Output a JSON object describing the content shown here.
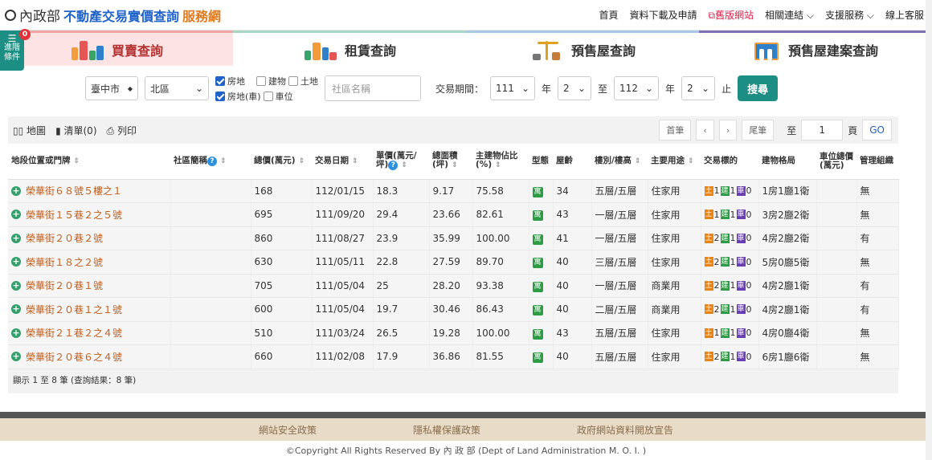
{
  "brand": {
    "ministry": "內政部",
    "title_blue": "不動產交易實價查詢",
    "title_orange": "服務網"
  },
  "topnav": [
    "首頁",
    "資料下載及申請",
    "舊版網站",
    "相關連結 ⌵",
    "支援服務 ⌵",
    "線上客服"
  ],
  "adv": {
    "label": "進階條件",
    "badge": "0"
  },
  "tabs": [
    "買賣查詢",
    "租賃查詢",
    "預售屋查詢",
    "預售屋建案查詢"
  ],
  "filters": {
    "city": "臺中市",
    "district": "北區",
    "chk1": "房地",
    "chk2": "建物",
    "chk3": "土地",
    "chk4": "房地(車)",
    "chk5": "車位",
    "community_placeholder": "社區名稱",
    "period_label": "交易期間：",
    "y1": "111",
    "m1": "2",
    "to": "至",
    "y2": "112",
    "m2": "2",
    "year": "年",
    "stop": "止",
    "search": "搜尋"
  },
  "tools": {
    "map": "地圖",
    "list": "清單(0)",
    "print": "列印"
  },
  "pager": {
    "first": "首筆",
    "prev": "‹",
    "next": "›",
    "last": "尾筆",
    "to": "至",
    "page": "1",
    "page_unit": "頁",
    "go": "GO"
  },
  "columns": [
    "地段位置或門牌",
    "社區簡稱",
    "總價(萬元)",
    "交易日期",
    "單價(萬元/坪)",
    "總面積(坪)",
    "主建物佔比(%)",
    "型態",
    "屋齡",
    "樓別/樓高",
    "主要用途",
    "交易標的",
    "建物格局",
    "車位總價(萬元)",
    "管理組織"
  ],
  "rows": [
    {
      "addr": "榮華街６８號５樓之１",
      "total": "168",
      "date": "112/01/15",
      "unit": "18.3",
      "area": "9.17",
      "ratio": "75.58",
      "type": "寓",
      "age": "34",
      "floor": "五層/五層",
      "use": "住家用",
      "l": "1",
      "b": "1",
      "c": "0",
      "layout": "1房1廳1衛",
      "park": "",
      "mgmt": "無"
    },
    {
      "addr": "榮華街１５巷２之５號",
      "total": "695",
      "date": "111/09/20",
      "unit": "29.4",
      "area": "23.66",
      "ratio": "82.61",
      "type": "寓",
      "age": "43",
      "floor": "一層/五層",
      "use": "住家用",
      "l": "1",
      "b": "1",
      "c": "0",
      "layout": "3房2廳2衛",
      "park": "",
      "mgmt": "無"
    },
    {
      "addr": "榮華街２０巷２號",
      "total": "860",
      "date": "111/08/27",
      "unit": "23.9",
      "area": "35.99",
      "ratio": "100.00",
      "type": "寓",
      "age": "41",
      "floor": "一層/五層",
      "use": "住家用",
      "l": "2",
      "b": "1",
      "c": "0",
      "layout": "4房2廳2衛",
      "park": "",
      "mgmt": "有"
    },
    {
      "addr": "榮華街１８之２號",
      "total": "630",
      "date": "111/05/11",
      "unit": "22.8",
      "area": "27.59",
      "ratio": "89.70",
      "type": "寓",
      "age": "40",
      "floor": "三層/五層",
      "use": "住家用",
      "l": "2",
      "b": "1",
      "c": "0",
      "layout": "5房0廳5衛",
      "park": "",
      "mgmt": "無"
    },
    {
      "addr": "榮華街２０巷１號",
      "total": "705",
      "date": "111/05/04",
      "unit": "25",
      "area": "28.20",
      "ratio": "93.38",
      "type": "寓",
      "age": "40",
      "floor": "一層/五層",
      "use": "商業用",
      "l": "2",
      "b": "1",
      "c": "0",
      "layout": "4房2廳1衛",
      "park": "",
      "mgmt": "有"
    },
    {
      "addr": "榮華街２０巷１之１號",
      "total": "600",
      "date": "111/05/04",
      "unit": "19.7",
      "area": "30.46",
      "ratio": "86.43",
      "type": "寓",
      "age": "40",
      "floor": "二層/五層",
      "use": "商業用",
      "l": "2",
      "b": "1",
      "c": "0",
      "layout": "4房2廳1衛",
      "park": "",
      "mgmt": "有"
    },
    {
      "addr": "榮華街２１巷２之４號",
      "total": "510",
      "date": "111/03/24",
      "unit": "26.5",
      "area": "19.28",
      "ratio": "100.00",
      "type": "寓",
      "age": "43",
      "floor": "五層/五層",
      "use": "住家用",
      "l": "1",
      "b": "1",
      "c": "0",
      "layout": "4房0廳4衛",
      "park": "",
      "mgmt": "無"
    },
    {
      "addr": "榮華街２０巷６之４號",
      "total": "660",
      "date": "111/02/08",
      "unit": "17.9",
      "area": "36.86",
      "ratio": "81.55",
      "type": "寓",
      "age": "40",
      "floor": "五層/五層",
      "use": "住家用",
      "l": "2",
      "b": "1",
      "c": "0",
      "layout": "6房1廳6衛",
      "park": "",
      "mgmt": "無"
    }
  ],
  "summary": "顯示 1 至 8 筆 (查詢結果：8 筆)",
  "footer_links": [
    "網站安全政策",
    "隱私權保護政策",
    "政府網站資料開放宣告"
  ],
  "copyright": "©Copyright All Rights Reserved By 內 政 部 (Dept of Land Administration M. O. I. )"
}
